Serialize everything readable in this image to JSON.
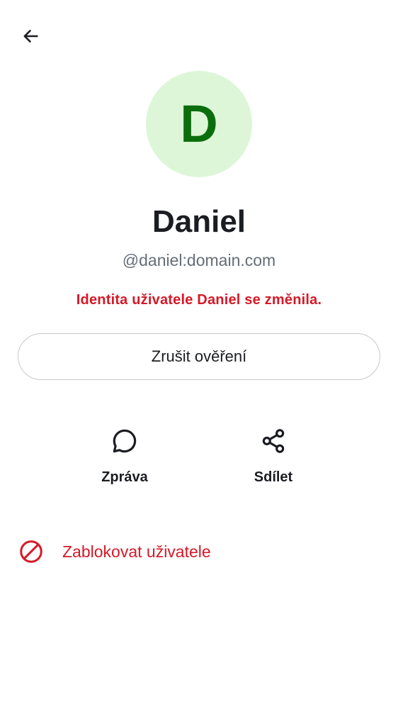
{
  "header": {
    "back_icon": "arrow-left-icon"
  },
  "profile": {
    "avatar_letter": "D",
    "avatar_bg": "#ddf6d8",
    "avatar_fg": "#0b6e0d",
    "display_name": "Daniel",
    "user_id": "@daniel:domain.com",
    "identity_warning": "Identita uživatele Daniel se změnila."
  },
  "buttons": {
    "withdraw_verification": "Zrušit ověření"
  },
  "actions": [
    {
      "label": "Zpráva",
      "icon": "chat-bubble-icon"
    },
    {
      "label": "Sdílet",
      "icon": "share-icon"
    }
  ],
  "block": {
    "label": "Zablokovat uživatele",
    "icon": "block-icon"
  },
  "colors": {
    "critical": "#d51928",
    "text_primary": "#1b1d22",
    "text_secondary": "#656d77"
  }
}
